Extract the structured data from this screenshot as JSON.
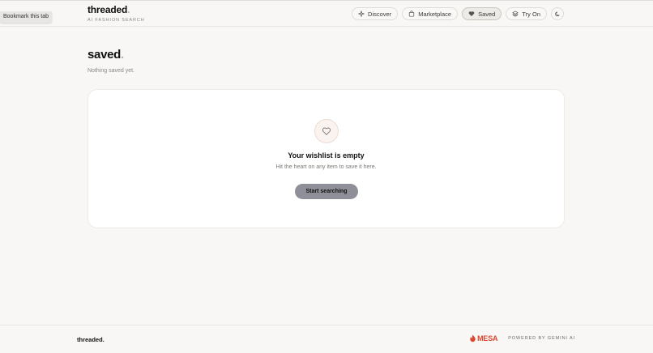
{
  "tooltip": {
    "text": "Bookmark this tab"
  },
  "header": {
    "brand_name": "threaded",
    "brand_dot": ".",
    "tagline": "AI FASHION SEARCH",
    "nav": [
      {
        "label": "Discover",
        "icon": "sparkle-icon"
      },
      {
        "label": "Marketplace",
        "icon": "store-icon"
      },
      {
        "label": "Saved",
        "icon": "heart-icon",
        "active": true
      },
      {
        "label": "Try On",
        "icon": "layers-icon"
      }
    ],
    "theme_toggle_icon": "moon-icon"
  },
  "main": {
    "title": "saved",
    "title_dot": ".",
    "subtitle": "Nothing saved yet.",
    "empty_state": {
      "icon": "heart-outline-icon",
      "title": "Your wishlist is empty",
      "description": "Hit the heart on any item to save it here.",
      "cta_label": "Start searching"
    }
  },
  "footer": {
    "brand": "threaded.",
    "partner_logo_text": "MESA",
    "powered_by": "POWERED BY GEMINI AI"
  },
  "colors": {
    "background": "#f8f7f5",
    "card": "#ffffff",
    "cta": "#8f8f99",
    "accent_brand_dot": "#b8b3ab",
    "mesa_red": "#d9462d"
  }
}
